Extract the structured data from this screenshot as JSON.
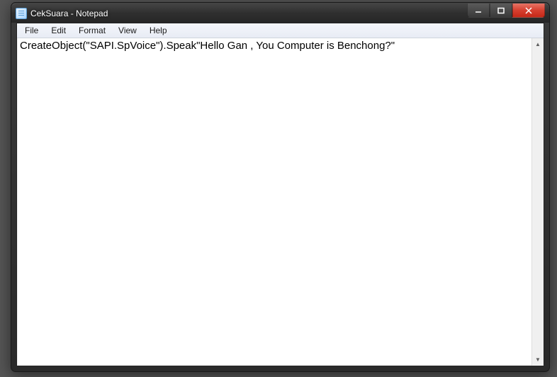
{
  "window": {
    "title": "CekSuara - Notepad"
  },
  "menu": {
    "file": "File",
    "edit": "Edit",
    "format": "Format",
    "view": "View",
    "help": "Help"
  },
  "editor": {
    "content": "CreateObject(\"SAPI.SpVoice\").Speak\"Hello Gan , You Computer is Benchong?\""
  },
  "icons": {
    "minimize": "minimize-icon",
    "maximize": "maximize-icon",
    "close": "close-icon",
    "scroll_up": "▲",
    "scroll_down": "▼"
  }
}
